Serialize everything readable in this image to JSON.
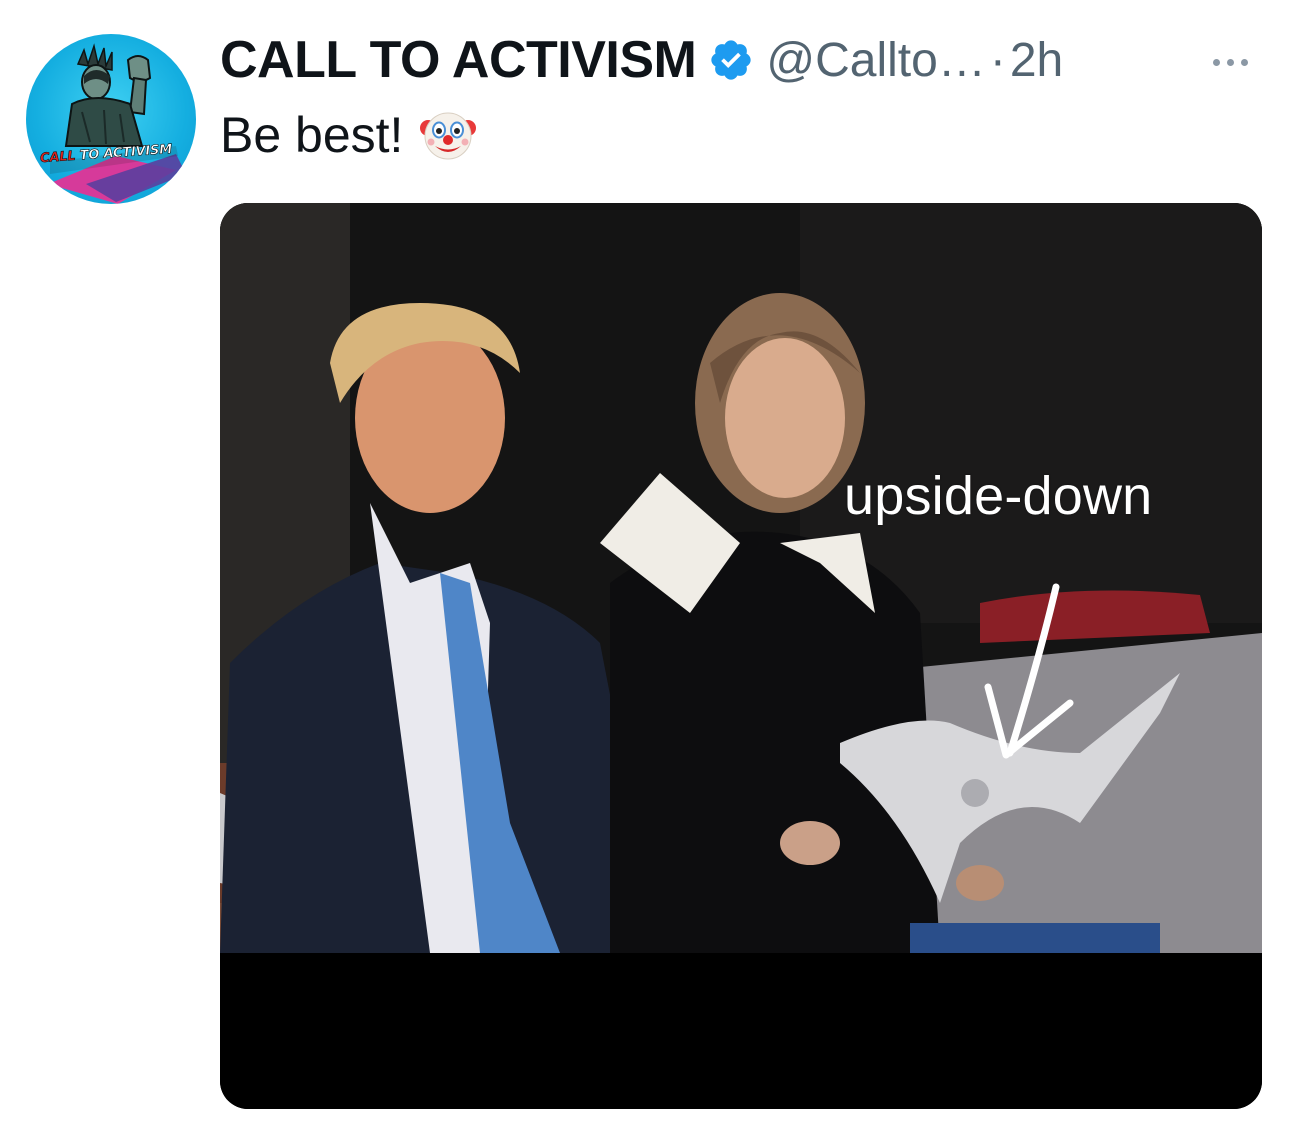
{
  "tweet": {
    "author": {
      "display_name": "CALL TO ACTIVISM",
      "handle": "@Callto…",
      "verified": true,
      "avatar_wordmark": [
        "CALL",
        "TO ACTIVISM"
      ]
    },
    "separator": "·",
    "time": "2h",
    "text": "Be best!",
    "emoji": "clown-face",
    "media": {
      "overlay_text": "upside-down"
    }
  },
  "colors": {
    "accent": "#1d9bf0",
    "text_primary": "#0f1419",
    "text_secondary": "#536471"
  },
  "icons": [
    "verified-badge-icon",
    "more-options-icon",
    "clown-emoji-icon",
    "arrow-icon"
  ]
}
